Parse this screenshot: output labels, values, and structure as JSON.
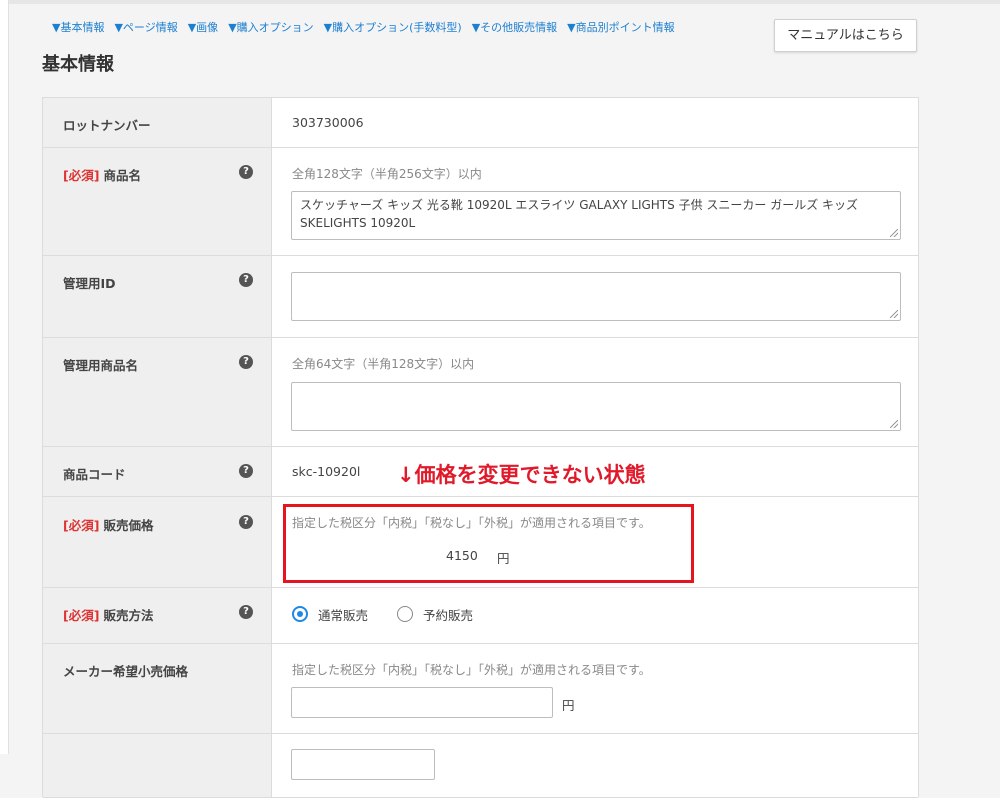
{
  "nav": {
    "links": [
      "▼基本情報",
      "▼ページ情報",
      "▼画像",
      "▼購入オプション",
      "▼購入オプション(手数料型)",
      "▼その他販売情報",
      "▼商品別ポイント情報"
    ]
  },
  "manual_button": "マニュアルはこちら",
  "section_title": "基本情報",
  "required_tag": "[必須]",
  "help_glyph": "?",
  "rows": {
    "lot": {
      "label": "ロットナンバー",
      "value": "303730006"
    },
    "product_name": {
      "label": "商品名",
      "hint": "全角128文字（半角256文字）以内",
      "value": "スケッチャーズ キッズ 光る靴 10920L エスライツ GALAXY LIGHTS 子供 スニーカー ガールズ キッズ SKELIGHTS 10920L"
    },
    "admin_id": {
      "label": "管理用ID",
      "value": ""
    },
    "admin_name": {
      "label": "管理用商品名",
      "hint": "全角64文字（半角128文字）以内",
      "value": ""
    },
    "product_code": {
      "label": "商品コード",
      "value": "skc-10920l"
    },
    "sale_price": {
      "label": "販売価格",
      "hint": "指定した税区分「内税」「税なし」「外税」が適用される項目です。",
      "value": "4150",
      "unit": "円"
    },
    "sale_method": {
      "label": "販売方法",
      "options": [
        "通常販売",
        "予約販売"
      ],
      "selected": "通常販売"
    },
    "msrp": {
      "label": "メーカー希望小売価格",
      "hint": "指定した税区分「内税」「税なし」「外税」が適用される項目です。",
      "value": "",
      "unit": "円"
    }
  },
  "annotation": "↓価格を変更できない状態",
  "colors": {
    "link": "#1d7fd0",
    "required": "#dd3333",
    "annotation": "#e01a2a",
    "radio_selected": "#1e88e5"
  }
}
